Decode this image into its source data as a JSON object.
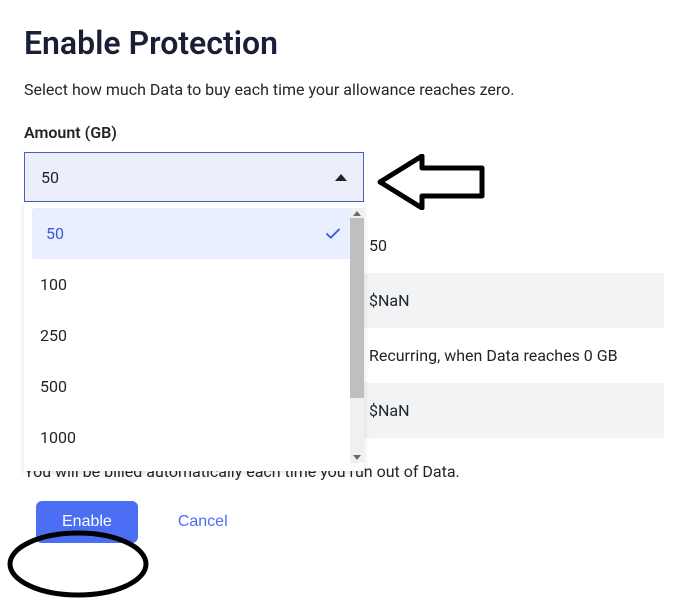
{
  "title": "Enable Protection",
  "description": "Select how much Data to buy each time your allowance reaches zero.",
  "amount_label": "Amount (GB)",
  "select": {
    "current": "50",
    "options": [
      "50",
      "100",
      "250",
      "500",
      "1000"
    ]
  },
  "rows": {
    "val1": "50",
    "val2": "$NaN",
    "val3": "Recurring, when Data reaches 0 GB",
    "val4": "$NaN"
  },
  "billing_note": "You will be billed automatically each time you run out of Data.",
  "buttons": {
    "enable": "Enable",
    "cancel": "Cancel"
  }
}
